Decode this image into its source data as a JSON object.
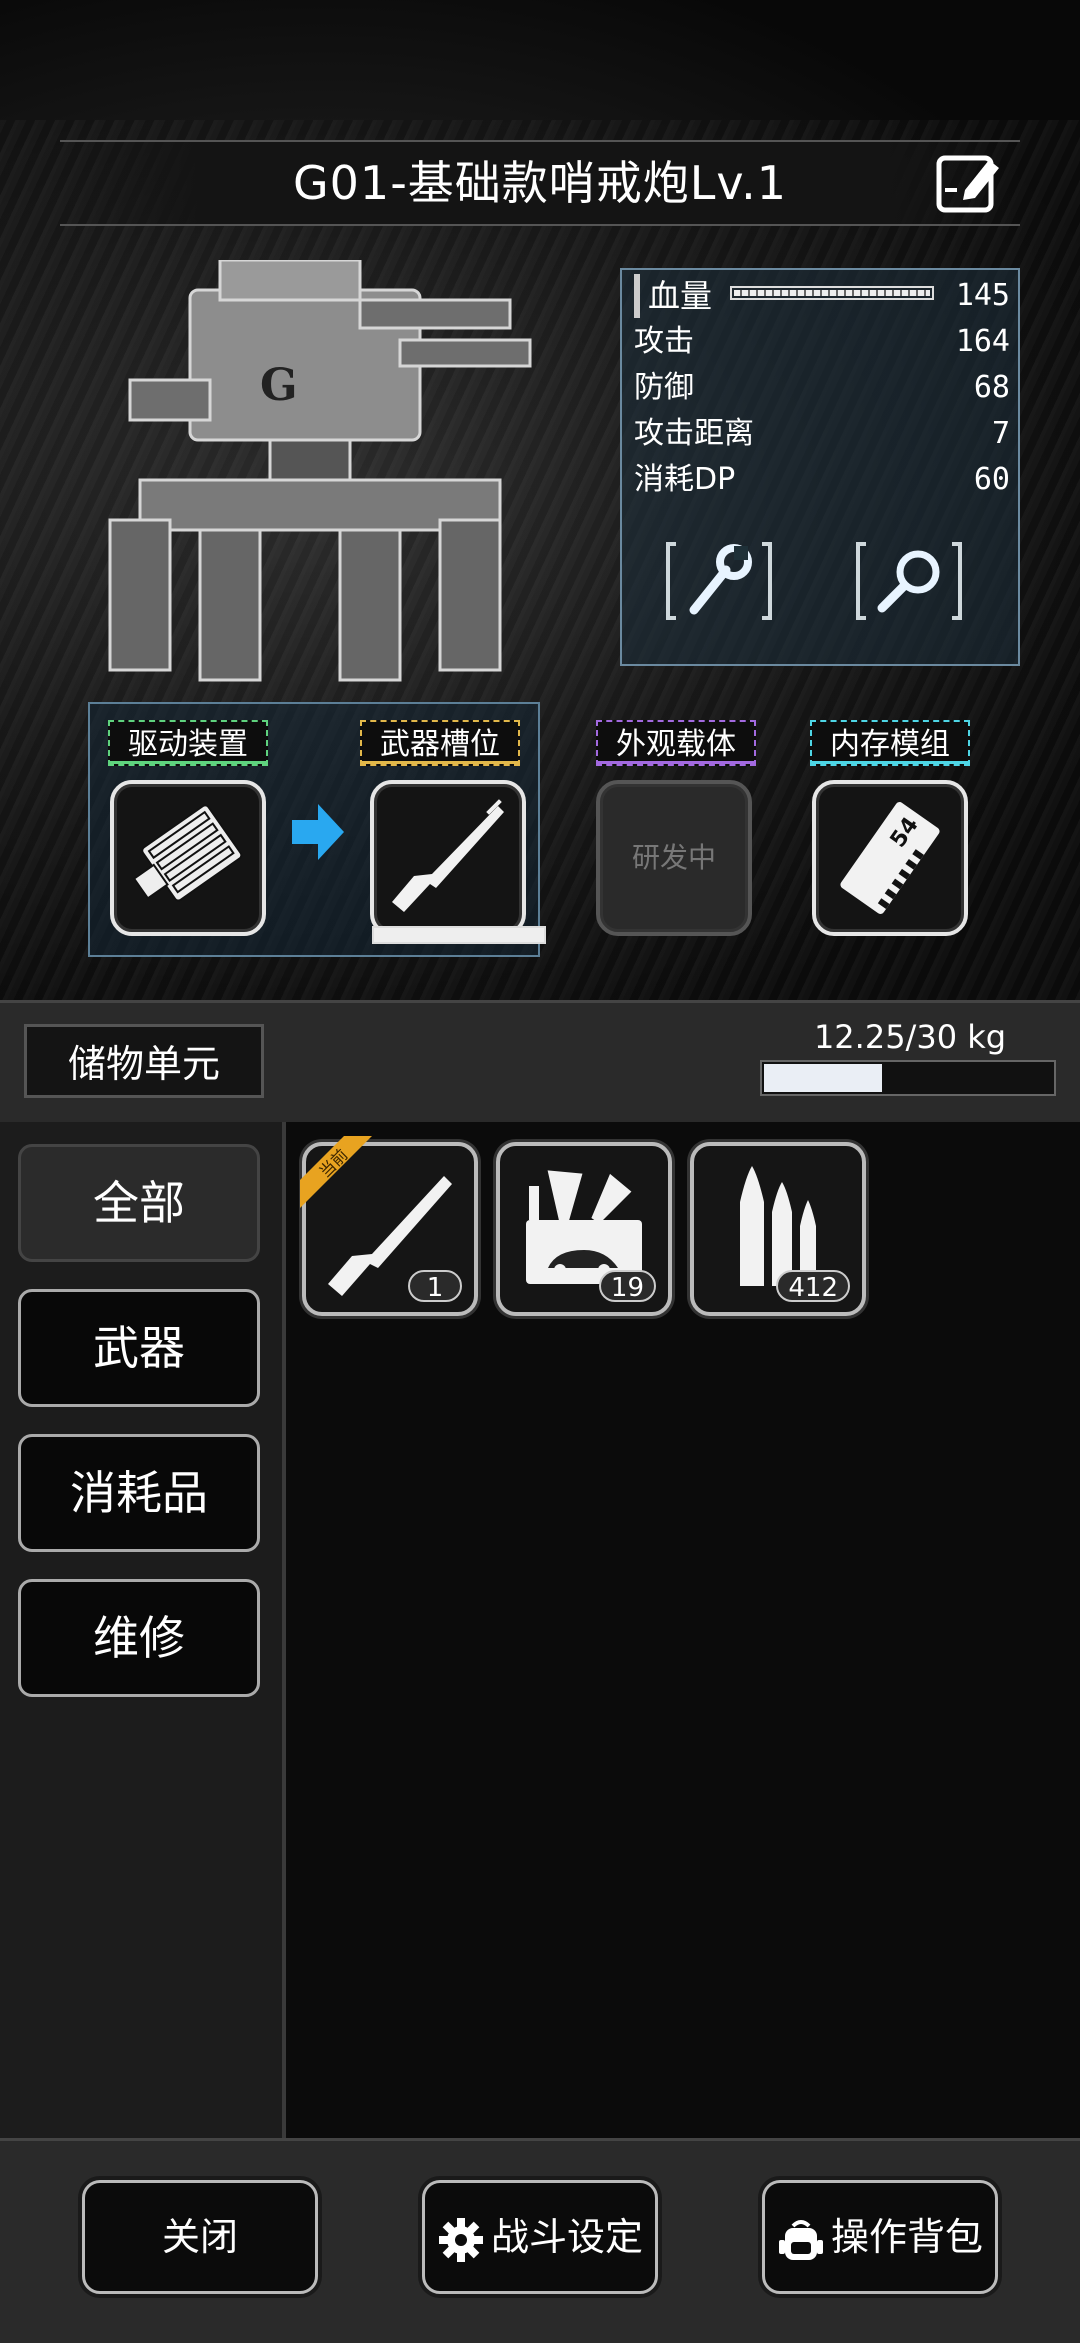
{
  "header": {
    "title": "G01-基础款哨戒炮Lv.1"
  },
  "stats": {
    "hp_label": "血量",
    "hp_value": "145",
    "hp_fill": 1.0,
    "rows": [
      {
        "label": "攻击",
        "value": "164"
      },
      {
        "label": "防御",
        "value": "68"
      },
      {
        "label": "攻击距离",
        "value": "7"
      },
      {
        "label": "消耗DP",
        "value": "60"
      }
    ]
  },
  "slots": {
    "drive": {
      "label": "驱动装置",
      "color": "#5fd37e"
    },
    "weapon": {
      "label": "武器槽位",
      "color": "#e2b84a"
    },
    "appearance": {
      "label": "外观载体",
      "color": "#a36ae0",
      "status": "研发中"
    },
    "memory": {
      "label": "内存模组",
      "color": "#4ed6e6",
      "chip_number": "54"
    }
  },
  "storage": {
    "title": "储物单元",
    "weight_text": "12.25/30 kg",
    "weight_fill": 0.408
  },
  "categories": [
    "全部",
    "武器",
    "消耗品",
    "维修"
  ],
  "items": [
    {
      "icon": "rifle-icon",
      "count": "1",
      "equipped_tag": "当前"
    },
    {
      "icon": "repair-kit-icon",
      "count": "19"
    },
    {
      "icon": "ammo-icon",
      "count": "412"
    }
  ],
  "footer": {
    "close": "关闭",
    "battle_settings": "战斗设定",
    "backpack": "操作背包"
  }
}
